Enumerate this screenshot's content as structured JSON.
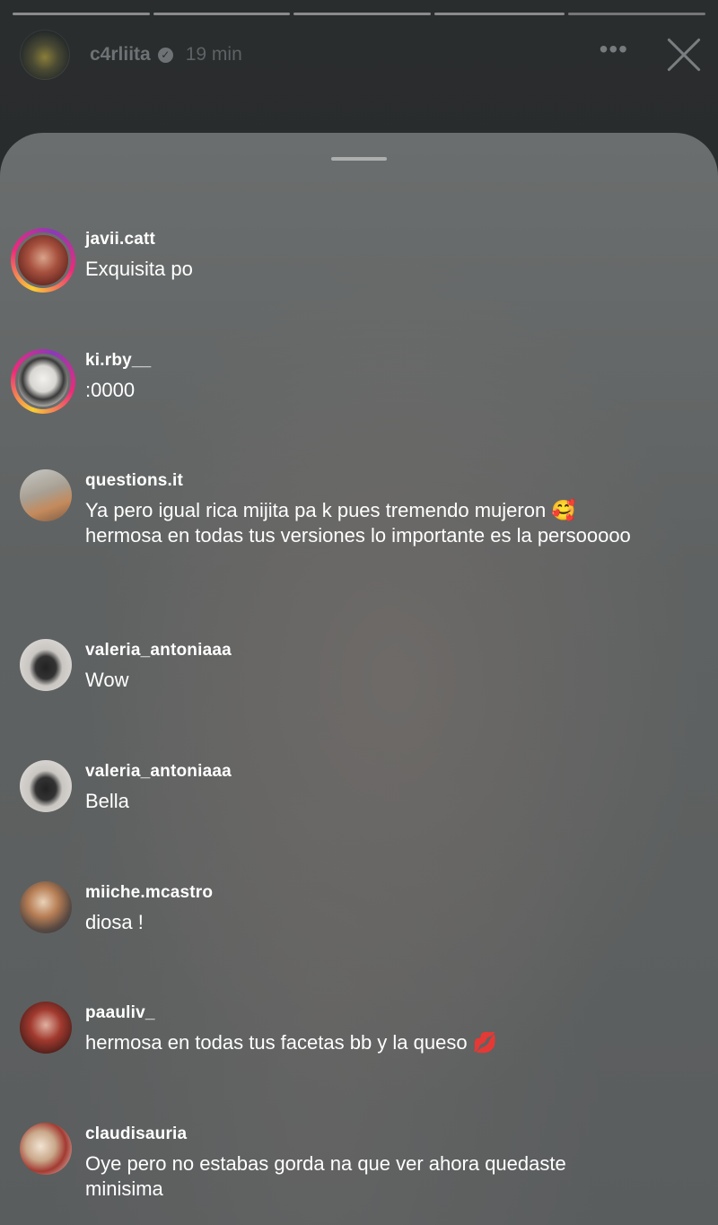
{
  "story": {
    "username": "c4rliita",
    "time": "19 min",
    "more_icon": "more-horizontal-icon",
    "close_icon": "close-icon",
    "progress_segments": 5
  },
  "replies": [
    {
      "username": "javii.catt",
      "text": "Exquisita po",
      "has_story": true
    },
    {
      "username": "ki.rby__",
      "text": ":0000",
      "has_story": true
    },
    {
      "username": "questions.it",
      "text": "Ya pero igual rica mijita pa k pues tremendo mujeron 🥰 hermosa en todas tus versiones lo importante es la persooooo",
      "has_story": false
    },
    {
      "username": "valeria_antoniaaa",
      "text": "Wow",
      "has_story": false
    },
    {
      "username": "valeria_antoniaaa",
      "text": "Bella",
      "has_story": false
    },
    {
      "username": "miiche.mcastro",
      "text": "diosa !",
      "has_story": false
    },
    {
      "username": "paauliv_",
      "text": "hermosa en todas tus facetas bb y la queso 💋",
      "has_story": false
    },
    {
      "username": "claudisauria",
      "text": "Oye pero no estabas gorda na que ver ahora quedaste minisima",
      "has_story": false
    }
  ]
}
